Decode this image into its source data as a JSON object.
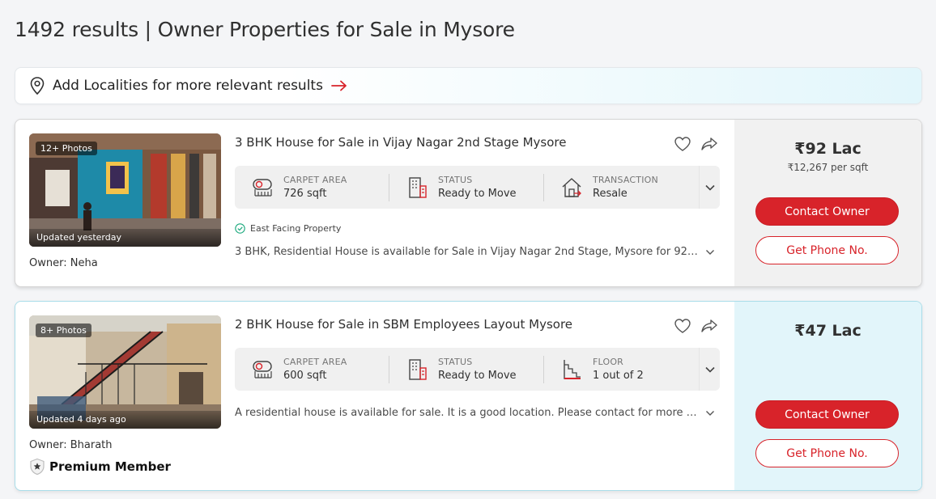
{
  "header": {
    "title": "1492 results | Owner Properties for Sale in Mysore"
  },
  "locality_bar": {
    "text": "Add Localities for more relevant results",
    "icon": "location-pin-icon",
    "arrow_icon": "arrow-right-icon"
  },
  "colors": {
    "brand_red": "#d8232a",
    "premium_panel": "#e2f5fa",
    "standard_panel": "#f1f1f1"
  },
  "listings": [
    {
      "photos_badge": "12+ Photos",
      "updated": "Updated yesterday",
      "owner": "Owner: Neha",
      "title": "3 BHK House for Sale in Vijay Nagar 2nd Stage Mysore",
      "summary": [
        {
          "label": "CARPET AREA",
          "value": "726 sqft",
          "icon": "carpet-area-icon"
        },
        {
          "label": "STATUS",
          "value": "Ready to Move",
          "icon": "building-status-icon"
        },
        {
          "label": "TRANSACTION",
          "value": "Resale",
          "icon": "house-transaction-icon"
        }
      ],
      "highlight": "East Facing Property",
      "description": "3 BHK, Residential House is available for Sale in Vijay Nagar 2nd Stage, Mysore for 92.0 ...",
      "price": "₹92 Lac",
      "price_per_sqft": "₹12,267 per sqft",
      "contact_label": "Contact Owner",
      "phone_label": "Get Phone No."
    },
    {
      "photos_badge": "8+ Photos",
      "updated": "Updated 4 days ago",
      "owner": "Owner: Bharath",
      "premium": "Premium Member",
      "title": "2 BHK House for Sale in SBM Employees Layout Mysore",
      "summary": [
        {
          "label": "CARPET AREA",
          "value": "600 sqft",
          "icon": "carpet-area-icon"
        },
        {
          "label": "STATUS",
          "value": "Ready to Move",
          "icon": "building-status-icon"
        },
        {
          "label": "FLOOR",
          "value": "1 out of 2",
          "icon": "stairs-floor-icon"
        }
      ],
      "description": "A residential house is available for sale. It is a good location. Please contact for more de...",
      "price": "₹47 Lac",
      "contact_label": "Contact Owner",
      "phone_label": "Get Phone No."
    }
  ]
}
